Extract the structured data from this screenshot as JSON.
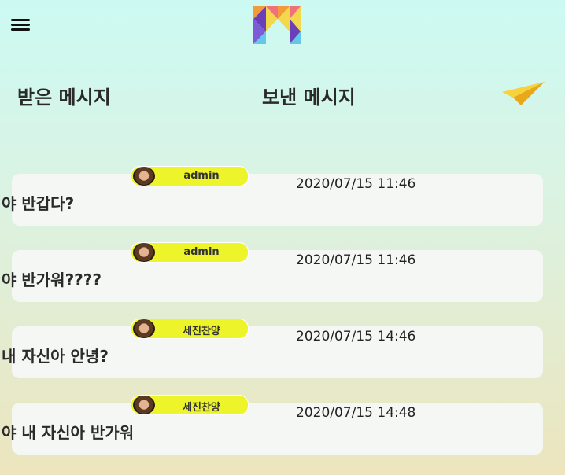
{
  "header": {
    "menu_icon": "hamburger-menu-icon",
    "logo_icon": "m-logo-icon"
  },
  "tabs": {
    "received_label": "받은 메시지",
    "sent_label": "보낸 메시지",
    "send_icon": "paper-plane-icon"
  },
  "colors": {
    "badge": "#eef42a",
    "card": "#f5f7f5",
    "plane": "#f2c21c"
  },
  "messages": [
    {
      "sender": "admin",
      "time": "2020/07/15 11:46",
      "text": "야 반갑다?"
    },
    {
      "sender": "admin",
      "time": "2020/07/15 11:46",
      "text": "야 반가워????"
    },
    {
      "sender": "세진찬양",
      "time": "2020/07/15 14:46",
      "text": "내 자신아 안녕?"
    },
    {
      "sender": "세진찬양",
      "time": "2020/07/15 14:48",
      "text": "야 내 자신아 반가워"
    }
  ]
}
